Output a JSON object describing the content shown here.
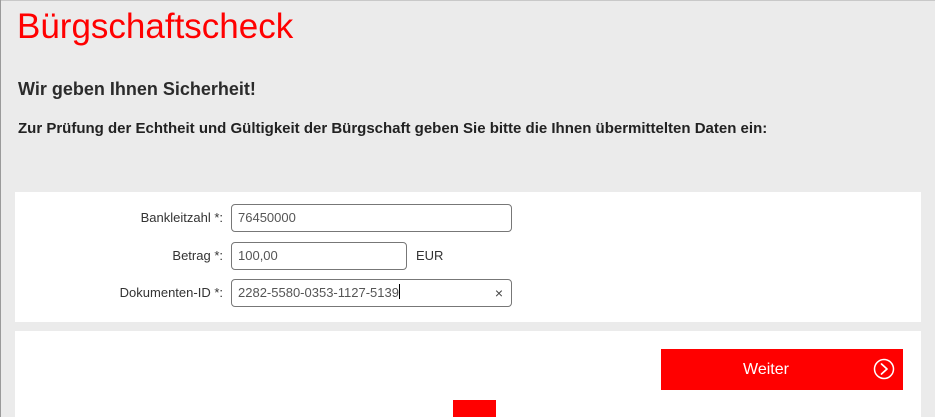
{
  "header": {
    "title": "Bürgschaftscheck",
    "subtitle": "Wir geben Ihnen Sicherheit!",
    "instruction": "Zur Prüfung der Echtheit und Gültigkeit der Bürgschaft geben Sie bitte die Ihnen übermittelten Daten ein:"
  },
  "form": {
    "bank_code": {
      "label": "Bankleitzahl *:",
      "value": "76450000"
    },
    "amount": {
      "label": "Betrag *:",
      "value": "100,00",
      "unit": "EUR"
    },
    "document_id": {
      "label": "Dokumenten-ID *:",
      "value": "2282-5580-0353-1127-5139",
      "clear_symbol": "×"
    }
  },
  "actions": {
    "submit_label": "Weiter",
    "submit_icon": "circle-arrow-right-icon"
  },
  "colors": {
    "brand_red": "#ff0000",
    "page_background": "#ebebeb",
    "panel_background": "#ffffff"
  }
}
